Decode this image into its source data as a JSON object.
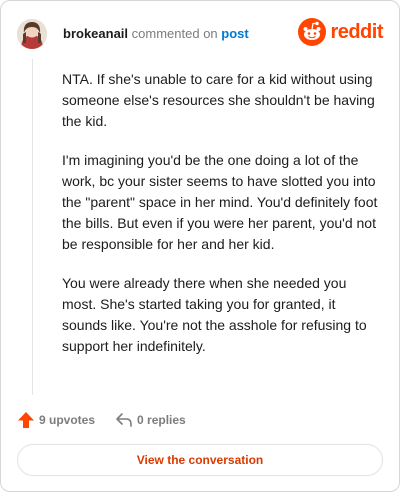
{
  "header": {
    "username": "brokeanail",
    "verb": "commented on",
    "post_link": "post",
    "brand": "reddit"
  },
  "comment": {
    "paragraphs": [
      "NTA. If she's unable to care for a kid without using someone else's resources she shouldn't be having the kid.",
      "I'm imagining you'd be the one doing a lot of the work, bc your sister seems to have slotted you into the \"parent\" space in her mind. You'd definitely foot the bills. But even if you were her parent, you'd not be responsible for her and her kid.",
      "You were already there when she needed you most. She's started taking you for granted, it sounds like. You're not the asshole for refusing to support her indefinitely."
    ]
  },
  "actions": {
    "upvotes": "9 upvotes",
    "replies": "0 replies",
    "upvote_icon": "upvote-arrow-icon",
    "reply_icon": "reply-arrow-icon"
  },
  "cta": {
    "label": "View the conversation"
  },
  "colors": {
    "brand": "#ff4500",
    "link": "#0079d3",
    "cta_text": "#d93a00",
    "muted": "#7c7c7c"
  }
}
